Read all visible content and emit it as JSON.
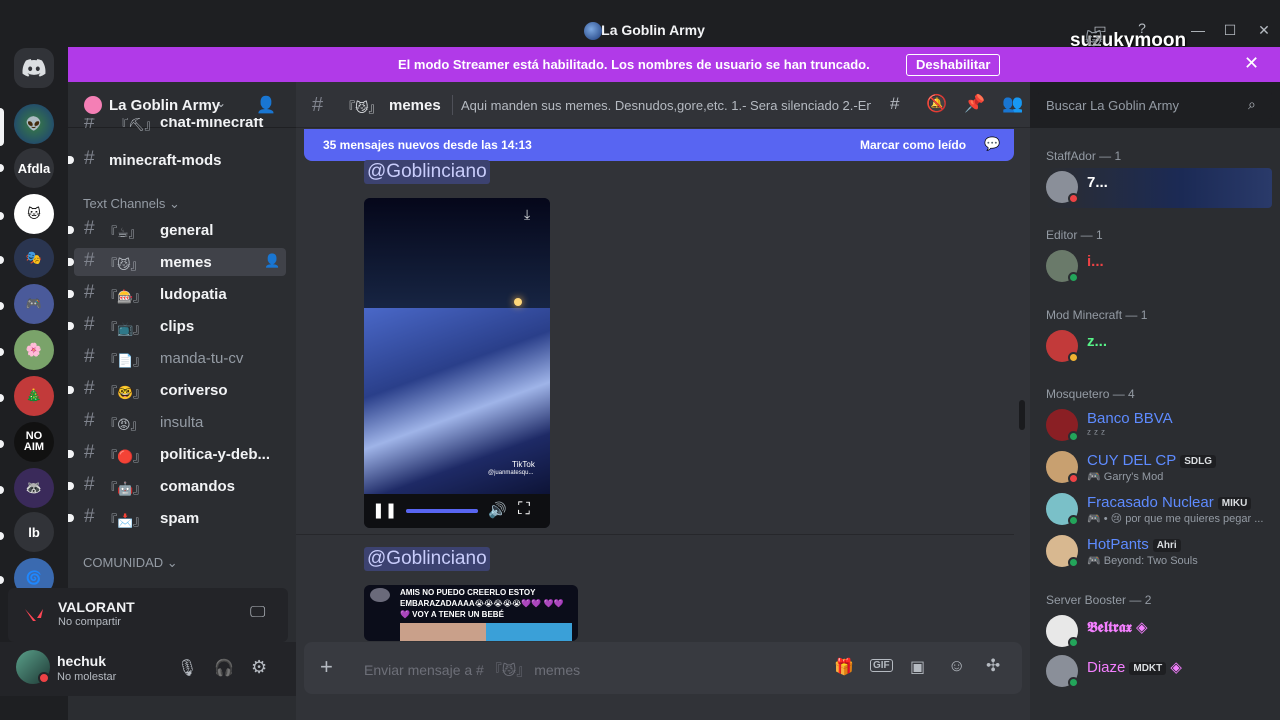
{
  "window": {
    "title": "La Goblin Army"
  },
  "overlay_username": "suzukymoon",
  "banner": {
    "text": "El modo Streamer está habilitado. Los nombres de usuario se han truncado.",
    "button": "Deshabilitar"
  },
  "rail": {
    "items": [
      "Afdla",
      "lb"
    ]
  },
  "server": {
    "name": "La Goblin Army"
  },
  "channels_top": [
    {
      "name": "chat-minecraft",
      "emoji": "『⛏』"
    },
    {
      "name": "minecraft-mods",
      "emoji": ""
    }
  ],
  "categories": {
    "text": "Text Channels",
    "community": "COMUNIDAD"
  },
  "channels": [
    {
      "emoji": "『☕』",
      "name": "general"
    },
    {
      "emoji": "『😼』",
      "name": "memes"
    },
    {
      "emoji": "『🎰』",
      "name": "ludopatia"
    },
    {
      "emoji": "『📺』",
      "name": "clips"
    },
    {
      "emoji": "『📄』",
      "name": "manda-tu-cv"
    },
    {
      "emoji": "『🤓』",
      "name": "coriverso"
    },
    {
      "emoji": "『😡』",
      "name": "insulta"
    },
    {
      "emoji": "『🔴』",
      "name": "politica-y-deb..."
    },
    {
      "emoji": "『🤖』",
      "name": "comandos"
    },
    {
      "emoji": "『📩』",
      "name": "spam"
    }
  ],
  "voice": {
    "title": "VALORANT",
    "subtitle": "No compartir"
  },
  "user": {
    "name": "hechuk",
    "status": "No molestar"
  },
  "channel_header": {
    "emoji": "『😼』",
    "name": "memes",
    "topic": "Aqui manden sus memes. Desnudos,gore,etc. 1.- Sera silenciado 2.-En ..."
  },
  "search": {
    "placeholder": "Buscar La Goblin Army"
  },
  "new_messages": {
    "text": "35 mensajes nuevos desde las 14:13",
    "action": "Marcar como leído"
  },
  "messages": [
    {
      "mention": "@Goblinciano",
      "watermark_1": "TikTok",
      "watermark_2": "@juanmatesqu..."
    },
    {
      "mention": "@Goblinciano",
      "meme_text": "AMIS NO PUEDO CREERLO ESTOY EMBARAZADAAAA😭😭😭😭😭💜💜 💜💜💜 VOY A TENER UN BEBÉ"
    }
  ],
  "composer": {
    "placeholder": "Enviar mensaje a # 『😼』 memes"
  },
  "members": {
    "groups": [
      {
        "label": "StaffAdor — 1",
        "members": [
          {
            "name": "7...",
            "color": "#ffffff",
            "sub": "",
            "tag": ""
          }
        ]
      },
      {
        "label": "Editor — 1",
        "members": [
          {
            "name": "i...",
            "color": "#ed4245",
            "sub": "",
            "tag": ""
          }
        ]
      },
      {
        "label": "Mod Minecraft — 1",
        "members": [
          {
            "name": "z...",
            "color": "#57f287",
            "sub": "",
            "tag": ""
          }
        ]
      },
      {
        "label": "Mosquetero — 4",
        "members": [
          {
            "name": "Banco BBVA",
            "color": "#5e8bff",
            "sub": "ᶻ ᶻ ᶻ",
            "tag": ""
          },
          {
            "name": "CUY DEL CP",
            "color": "#5e8bff",
            "sub": "Garry's Mod",
            "tag": "SDLG"
          },
          {
            "name": "Fracasado Nuclear",
            "color": "#5e8bff",
            "sub": "😢 por que me quieres pegar ...",
            "tag": "MIKU"
          },
          {
            "name": "HotPants",
            "color": "#5e8bff",
            "sub": "Beyond: Two Souls",
            "tag": "Ahri"
          }
        ]
      },
      {
        "label": "Server Booster — 2",
        "members": [
          {
            "name": "𝕭𝖊𝖑𝖙𝖗𝖆𝖝",
            "color": "#f47fff",
            "sub": "",
            "tag": ""
          },
          {
            "name": "Diaze",
            "color": "#f47fff",
            "sub": "",
            "tag": "MDKT"
          }
        ]
      }
    ]
  },
  "colors": {
    "accent": "#5865f2",
    "banner": "#b13ae8",
    "booster": "#f47fff"
  }
}
